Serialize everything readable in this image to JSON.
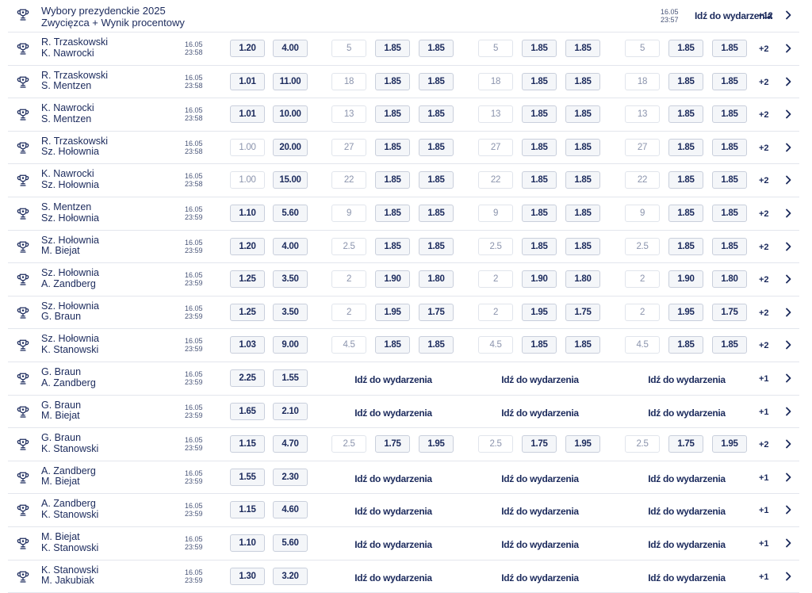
{
  "header": {
    "title": "Wybory prezydenckie 2025",
    "subtitle": "Zwycięzca + Wynik procentowy",
    "date": "16.05",
    "time": "23:57",
    "goto_label": "Idź do wydarzenia",
    "more": "+12"
  },
  "goto_label": "Idź do wydarzenia",
  "events": [
    {
      "a": "R. Trzaskowski",
      "b": "K. Nawrocki",
      "date": "16.05",
      "time": "23:58",
      "o1": "1.20",
      "o2": "4.00",
      "o1_dim": false,
      "lines": [
        "5",
        "5",
        "5"
      ],
      "lines_dim": true,
      "over": "1.85",
      "under": "1.85",
      "more": "+2"
    },
    {
      "a": "R. Trzaskowski",
      "b": "S. Mentzen",
      "date": "16.05",
      "time": "23:58",
      "o1": "1.01",
      "o2": "11.00",
      "o1_dim": false,
      "lines": [
        "18",
        "18",
        "18"
      ],
      "lines_dim": true,
      "over": "1.85",
      "under": "1.85",
      "more": "+2"
    },
    {
      "a": "K. Nawrocki",
      "b": "S. Mentzen",
      "date": "16.05",
      "time": "23:58",
      "o1": "1.01",
      "o2": "10.00",
      "o1_dim": false,
      "lines": [
        "13",
        "13",
        "13"
      ],
      "lines_dim": true,
      "over": "1.85",
      "under": "1.85",
      "more": "+2"
    },
    {
      "a": "R. Trzaskowski",
      "b": "Sz. Hołownia",
      "date": "16.05",
      "time": "23:58",
      "o1": "1.00",
      "o2": "20.00",
      "o1_dim": true,
      "lines": [
        "27",
        "27",
        "27"
      ],
      "lines_dim": true,
      "over": "1.85",
      "under": "1.85",
      "more": "+2"
    },
    {
      "a": "K. Nawrocki",
      "b": "Sz. Hołownia",
      "date": "16.05",
      "time": "23:58",
      "o1": "1.00",
      "o2": "15.00",
      "o1_dim": true,
      "lines": [
        "22",
        "22",
        "22"
      ],
      "lines_dim": true,
      "over": "1.85",
      "under": "1.85",
      "more": "+2"
    },
    {
      "a": "S. Mentzen",
      "b": "Sz. Hołownia",
      "date": "16.05",
      "time": "23:59",
      "o1": "1.10",
      "o2": "5.60",
      "o1_dim": false,
      "lines": [
        "9",
        "9",
        "9"
      ],
      "lines_dim": true,
      "over": "1.85",
      "under": "1.85",
      "more": "+2"
    },
    {
      "a": "Sz. Hołownia",
      "b": "M. Biejat",
      "date": "16.05",
      "time": "23:59",
      "o1": "1.20",
      "o2": "4.00",
      "o1_dim": false,
      "lines": [
        "2.5",
        "2.5",
        "2.5"
      ],
      "lines_dim": true,
      "over": "1.85",
      "under": "1.85",
      "more": "+2"
    },
    {
      "a": "Sz. Hołownia",
      "b": "A. Zandberg",
      "date": "16.05",
      "time": "23:59",
      "o1": "1.25",
      "o2": "3.50",
      "o1_dim": false,
      "lines": [
        "2",
        "2",
        "2"
      ],
      "lines_dim": true,
      "over": "1.90",
      "under": "1.80",
      "more": "+2"
    },
    {
      "a": "Sz. Hołownia",
      "b": "G. Braun",
      "date": "16.05",
      "time": "23:59",
      "o1": "1.25",
      "o2": "3.50",
      "o1_dim": false,
      "lines": [
        "2",
        "2",
        "2"
      ],
      "lines_dim": true,
      "over": "1.95",
      "under": "1.75",
      "more": "+2"
    },
    {
      "a": "Sz. Hołownia",
      "b": "K. Stanowski",
      "date": "16.05",
      "time": "23:59",
      "o1": "1.03",
      "o2": "9.00",
      "o1_dim": false,
      "lines": [
        "4.5",
        "4.5",
        "4.5"
      ],
      "lines_dim": true,
      "over": "1.85",
      "under": "1.85",
      "more": "+2"
    },
    {
      "a": "G. Braun",
      "b": "A. Zandberg",
      "date": "16.05",
      "time": "23:59",
      "o1": "2.25",
      "o2": "1.55",
      "o1_dim": false,
      "goto": true,
      "more": "+1"
    },
    {
      "a": "G. Braun",
      "b": "M. Biejat",
      "date": "16.05",
      "time": "23:59",
      "o1": "1.65",
      "o2": "2.10",
      "o1_dim": false,
      "goto": true,
      "more": "+1"
    },
    {
      "a": "G. Braun",
      "b": "K. Stanowski",
      "date": "16.05",
      "time": "23:59",
      "o1": "1.15",
      "o2": "4.70",
      "o1_dim": false,
      "lines": [
        "2.5",
        "2.5",
        "2.5"
      ],
      "lines_dim": true,
      "over": "1.75",
      "under": "1.95",
      "more": "+2"
    },
    {
      "a": "A. Zandberg",
      "b": "M. Biejat",
      "date": "16.05",
      "time": "23:59",
      "o1": "1.55",
      "o2": "2.30",
      "o1_dim": false,
      "goto": true,
      "more": "+1"
    },
    {
      "a": "A. Zandberg",
      "b": "K. Stanowski",
      "date": "16.05",
      "time": "23:59",
      "o1": "1.15",
      "o2": "4.60",
      "o1_dim": false,
      "goto": true,
      "more": "+1"
    },
    {
      "a": "M. Biejat",
      "b": "K. Stanowski",
      "date": "16.05",
      "time": "23:59",
      "o1": "1.10",
      "o2": "5.60",
      "o1_dim": false,
      "goto": true,
      "more": "+1"
    },
    {
      "a": "K. Stanowski",
      "b": "M. Jakubiak",
      "date": "16.05",
      "time": "23:59",
      "o1": "1.30",
      "o2": "3.20",
      "o1_dim": false,
      "goto": true,
      "more": "+1"
    }
  ],
  "icons": {
    "event": "trophy-icon",
    "expand": "chevron-right-icon"
  },
  "colors": {
    "text": "#1b2a5c",
    "border": "#c9cfdc",
    "button_bg": "#f4f6f9",
    "dim_text": "#8b94ad"
  }
}
